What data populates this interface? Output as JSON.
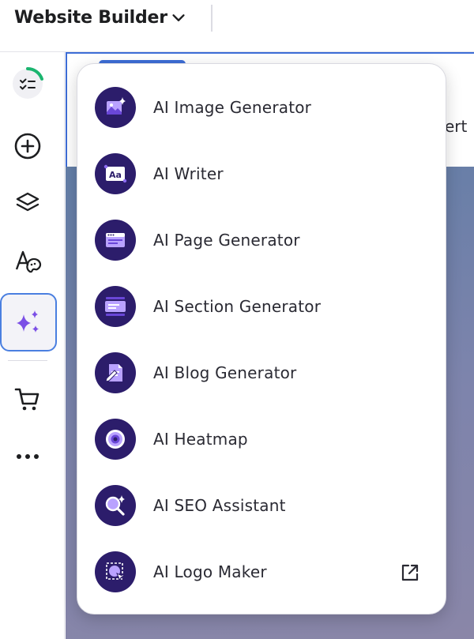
{
  "topbar": {
    "title": "Website Builder"
  },
  "sidebar": {
    "items": [
      {
        "name": "checklist-progress"
      },
      {
        "name": "add-element"
      },
      {
        "name": "layers"
      },
      {
        "name": "styles"
      },
      {
        "name": "ai-tools",
        "active": true
      },
      {
        "name": "store"
      },
      {
        "name": "more"
      }
    ]
  },
  "canvas": {
    "partial_text": "ert"
  },
  "ai_menu": {
    "items": [
      {
        "label": "AI Image Generator"
      },
      {
        "label": "AI Writer"
      },
      {
        "label": "AI Page Generator"
      },
      {
        "label": "AI Section Generator"
      },
      {
        "label": "AI Blog Generator"
      },
      {
        "label": "AI Heatmap"
      },
      {
        "label": "AI SEO Assistant"
      },
      {
        "label": "AI Logo Maker",
        "external": true
      }
    ]
  },
  "colors": {
    "icon_bg": "#2c1d6b",
    "accent_purple": "#8c6cf0",
    "active_border": "#4a7fe0",
    "progress_green": "#1bb56f"
  }
}
